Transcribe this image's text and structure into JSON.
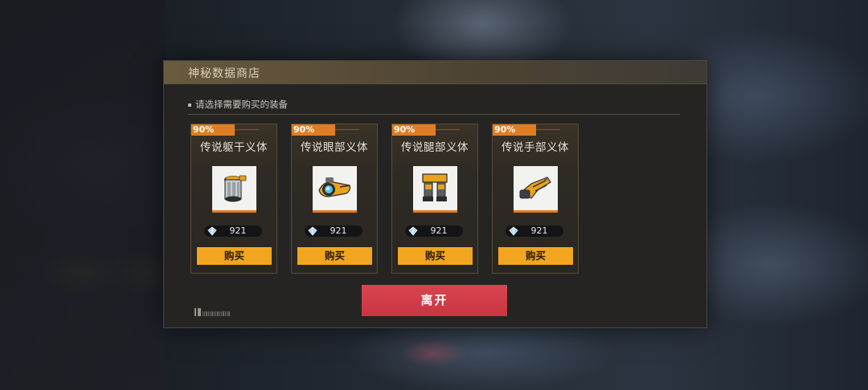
{
  "shop": {
    "title": "神秘数据商店",
    "section_label": "请选择需要购买的装备",
    "items": [
      {
        "discount": "90%",
        "name": "传说躯干义体",
        "price": "921",
        "buy_label": "购买",
        "icon": "torso-implant-icon"
      },
      {
        "discount": "90%",
        "name": "传说眼部义体",
        "price": "921",
        "buy_label": "购买",
        "icon": "eye-implant-icon"
      },
      {
        "discount": "90%",
        "name": "传说腿部义体",
        "price": "921",
        "buy_label": "购买",
        "icon": "leg-implant-icon"
      },
      {
        "discount": "90%",
        "name": "传说手部义体",
        "price": "921",
        "buy_label": "购买",
        "icon": "hand-implant-icon"
      }
    ],
    "leave_label": "离开",
    "currency_icon": "crystal-gem-icon"
  },
  "colors": {
    "accent_orange": "#e07d23",
    "buy_button": "#f2a51f",
    "leave_button": "#d8454f"
  }
}
